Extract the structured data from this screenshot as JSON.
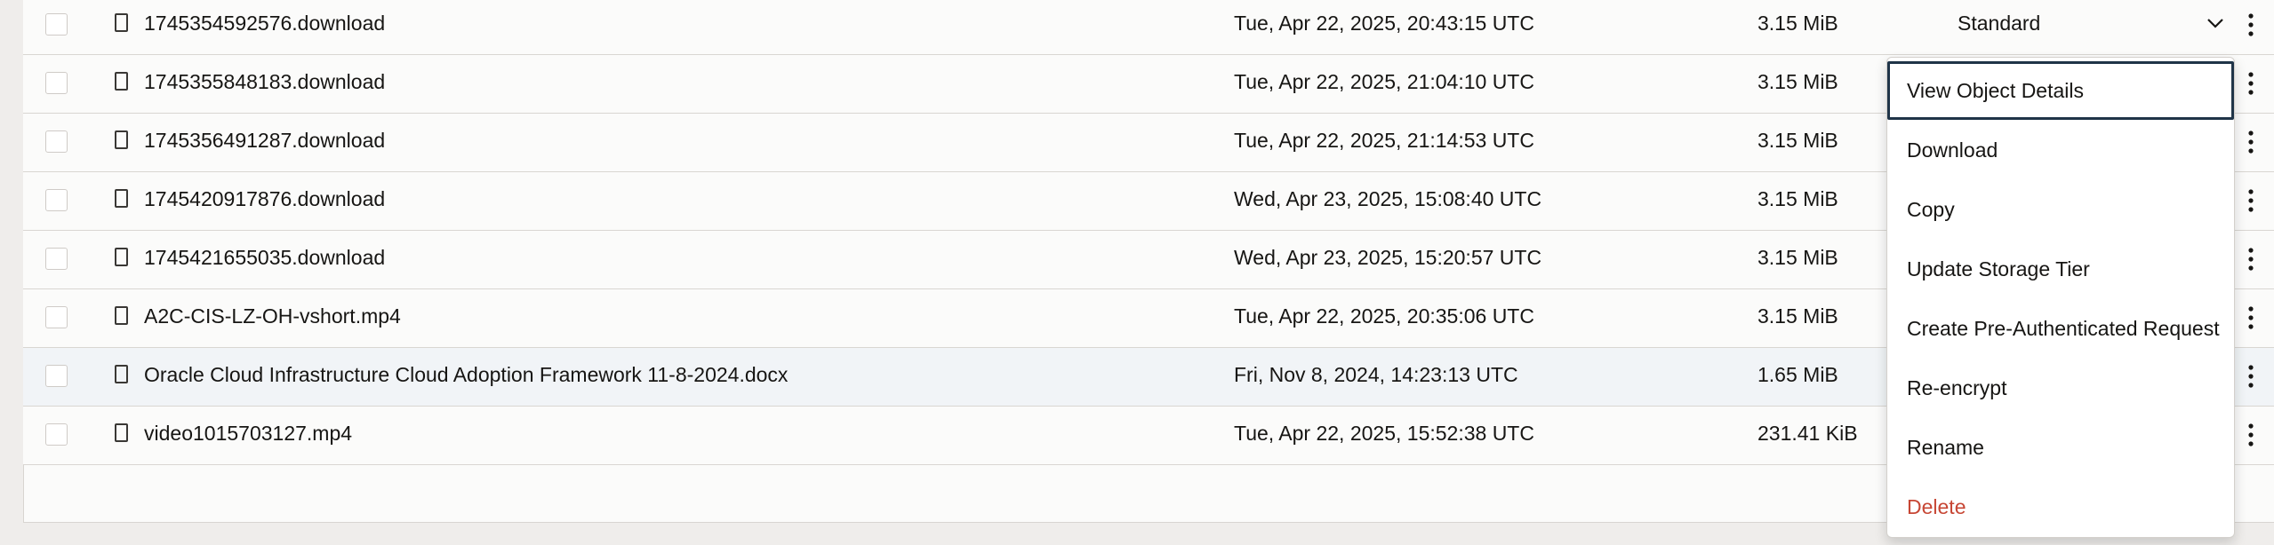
{
  "objects": [
    {
      "name": "1745354592576.download",
      "modified": "Tue, Apr 22, 2025, 20:43:15 UTC",
      "size": "3.15 MiB",
      "tier": "Standard"
    },
    {
      "name": "1745355848183.download",
      "modified": "Tue, Apr 22, 2025, 21:04:10 UTC",
      "size": "3.15 MiB"
    },
    {
      "name": "1745356491287.download",
      "modified": "Tue, Apr 22, 2025, 21:14:53 UTC",
      "size": "3.15 MiB"
    },
    {
      "name": "1745420917876.download",
      "modified": "Wed, Apr 23, 2025, 15:08:40 UTC",
      "size": "3.15 MiB"
    },
    {
      "name": "1745421655035.download",
      "modified": "Wed, Apr 23, 2025, 15:20:57 UTC",
      "size": "3.15 MiB"
    },
    {
      "name": "A2C-CIS-LZ-OH-vshort.mp4",
      "modified": "Tue, Apr 22, 2025, 20:35:06 UTC",
      "size": "3.15 MiB"
    },
    {
      "name": "Oracle Cloud Infrastructure Cloud Adoption Framework 11-8-2024.docx",
      "modified": "Fri, Nov 8, 2024, 14:23:13 UTC",
      "size": "1.65 MiB"
    },
    {
      "name": "video1015703127.mp4",
      "modified": "Tue, Apr 22, 2025, 15:52:38 UTC",
      "size": "231.41 KiB"
    }
  ],
  "actions_menu": {
    "items": [
      "View Object Details",
      "Download",
      "Copy",
      "Update Storage Tier",
      "Create Pre-Authenticated Request",
      "Re-encrypt",
      "Rename",
      "Delete"
    ]
  },
  "colors": {
    "page_bg": "#efedeb",
    "row_bg": "#fbfbfa",
    "row_highlight": "#f1f4f7",
    "focus_ring": "#1f3448",
    "danger": "#c74634"
  },
  "icons": {
    "file": "file-icon",
    "kebab": "kebab-icon",
    "dropdown": "chevron-down-icon"
  }
}
